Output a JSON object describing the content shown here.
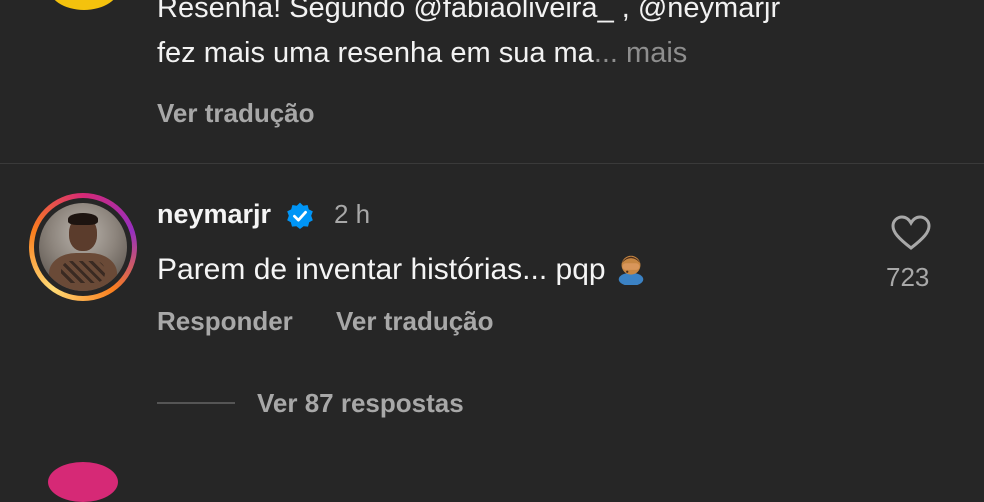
{
  "previous_comment": {
    "text_line1": "Resenha! Segundo @fabiaoliveira_ , @neymarjr",
    "text_line2": "fez mais uma resenha em sua ma",
    "more_label": "... mais",
    "translate_label": "Ver tradução"
  },
  "comment": {
    "username": "neymarjr",
    "time": "2 h",
    "text": "Parem de inventar histórias... pqp",
    "likes": "723",
    "reply_label": "Responder",
    "translate_label": "Ver tradução",
    "view_replies_label": "Ver 87 respostas"
  },
  "colors": {
    "background": "#262626",
    "secondary_text": "#a8a8a8",
    "verified_blue": "#0095f6",
    "story_ring": "#d62976"
  },
  "icons": {
    "verified": "verified-badge-icon",
    "like": "heart-outline-icon",
    "emoji": "facepalm-emoji"
  }
}
